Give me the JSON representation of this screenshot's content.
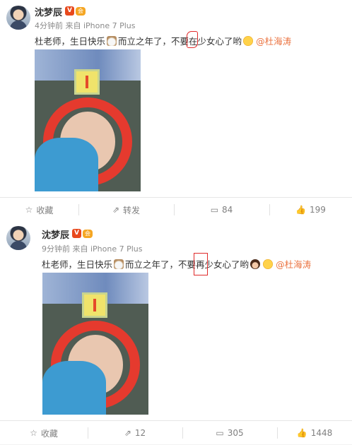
{
  "posts": [
    {
      "username": "沈梦辰",
      "verified_badge": "V",
      "member_badge": "会",
      "time": "4分钟前",
      "source": "来自 iPhone 7 Plus",
      "text_a": "杜老师，生日快乐",
      "text_b": " 而立之年了，不要",
      "marked_char": "在",
      "text_c": "少女心了哟",
      "mention": "@杜海涛",
      "photo_sign": "1",
      "actions": {
        "favorite": "收藏",
        "forward": "转发",
        "comment": "84",
        "like": "199"
      }
    },
    {
      "username": "沈梦辰",
      "verified_badge": "V",
      "member_badge": "会",
      "time": "9分钟前",
      "source": "来自 iPhone 7 Plus",
      "text_a": "杜老师，生日快乐",
      "text_b": " 而立之年了，不要",
      "marked_char": "再",
      "text_c": "少女心了哟",
      "mention": "@杜海涛",
      "photo_sign": "1",
      "actions": {
        "favorite": "收藏",
        "forward": "12",
        "comment": "305",
        "like": "1448"
      }
    }
  ],
  "icons": {
    "favorite": "star-icon",
    "forward": "forward-icon",
    "comment": "comment-icon",
    "like": "thumbs-up-icon"
  },
  "colors": {
    "mention": "#eb7340",
    "annotation": "#e02a2a",
    "background": "#f2f2f2"
  }
}
